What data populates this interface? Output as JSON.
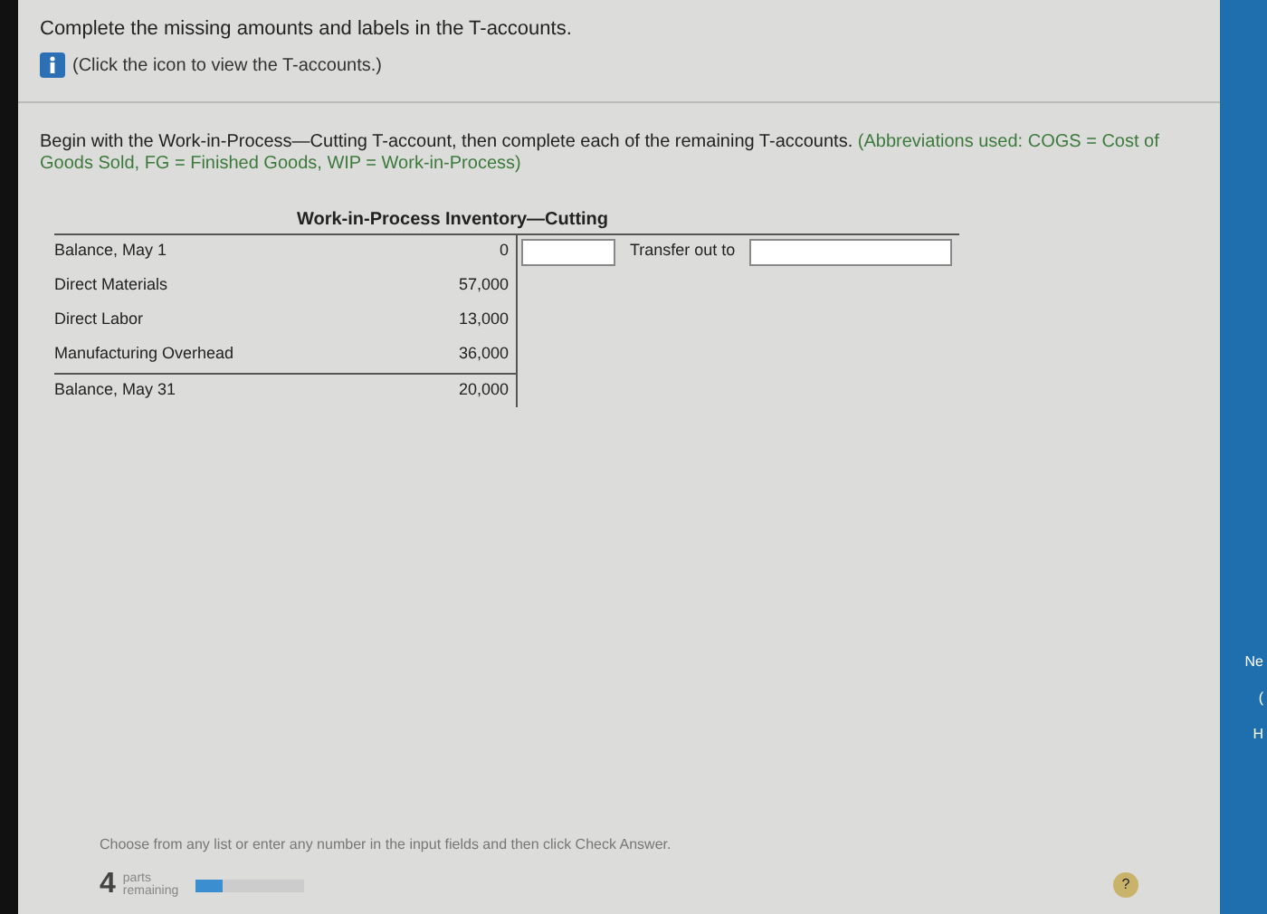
{
  "instructions": "Complete the missing amounts and labels in the T-accounts.",
  "info_link": "(Click the icon to view the T-accounts.)",
  "task": "Begin with the Work-in-Process—Cutting T-account, then complete each of the remaining T-accounts.",
  "abbreviations": "(Abbreviations used: COGS = Cost of Goods Sold, FG = Finished Goods, WIP = Work-in-Process)",
  "t_account": {
    "title": "Work-in-Process Inventory—Cutting",
    "debits": [
      {
        "label": "Balance, May 1",
        "amount": "0"
      },
      {
        "label": "Direct Materials",
        "amount": "57,000"
      },
      {
        "label": "Direct Labor",
        "amount": "13,000"
      },
      {
        "label": "Manufacturing Overhead",
        "amount": "36,000"
      }
    ],
    "debit_total": {
      "label": "Balance, May 31",
      "amount": "20,000"
    },
    "credit_label": "Transfer out to"
  },
  "footer": {
    "hint": "Choose from any list or enter any number in the input fields and then click Check Answer.",
    "parts_count": "4",
    "parts_label": "parts remaining",
    "level": 0.25,
    "help": "?"
  },
  "side_panel": {
    "lines": [
      "Ne",
      "(",
      "H"
    ]
  }
}
